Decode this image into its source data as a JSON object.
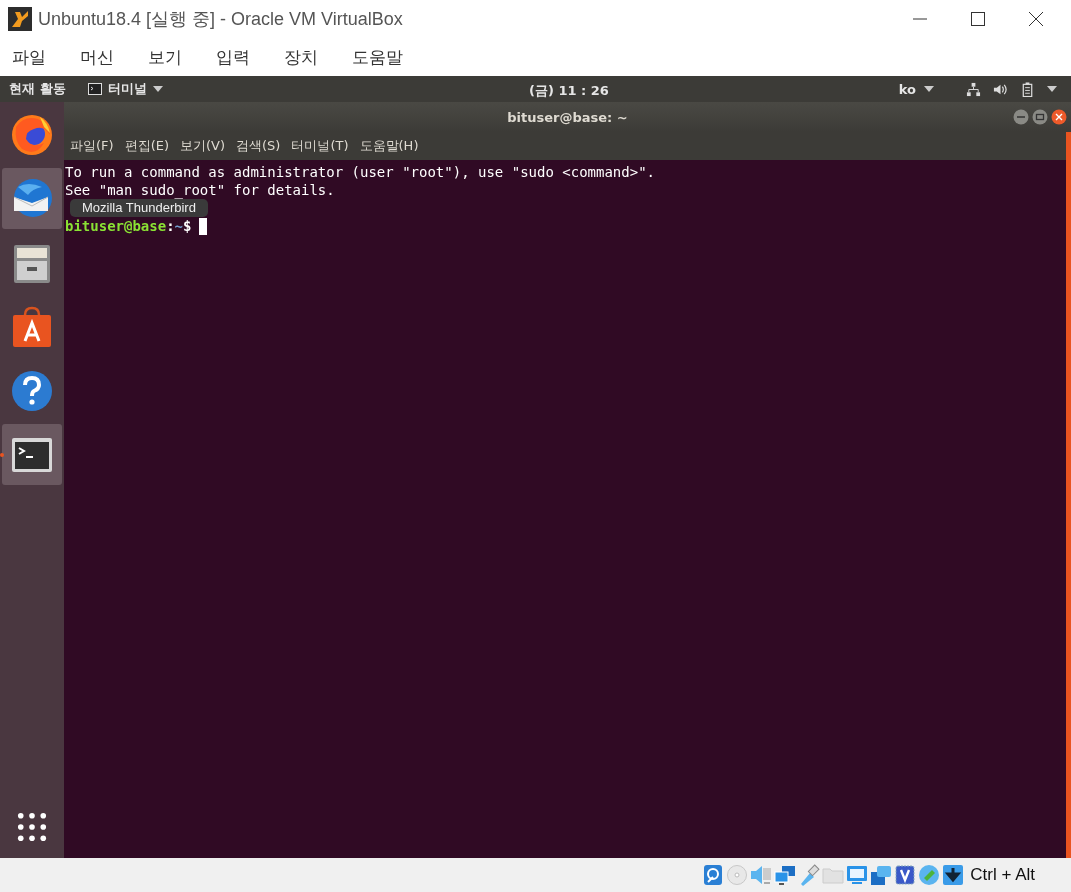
{
  "window": {
    "title": "Unbuntu18.4 [실행 중] - Oracle VM VirtualBox"
  },
  "menu": [
    "파일",
    "머신",
    "보기",
    "입력",
    "장치",
    "도움말"
  ],
  "top_bar": {
    "activities": "현재 활동",
    "app": "터미널",
    "clock": "(금) 11 : 26",
    "input_method": "ko"
  },
  "launcher": [
    {
      "kind": "firefox",
      "hovered": false,
      "running": false
    },
    {
      "kind": "thunderbird",
      "hovered": true,
      "running": false
    },
    {
      "kind": "files",
      "hovered": false,
      "running": false
    },
    {
      "kind": "software",
      "hovered": false,
      "running": false
    },
    {
      "kind": "help",
      "hovered": false,
      "running": false
    },
    {
      "kind": "terminal",
      "hovered": true,
      "running": true
    }
  ],
  "tooltip": "Mozilla Thunderbird",
  "terminal": {
    "title": "bituser@base: ~",
    "menu": [
      "파일(F)",
      "편집(E)",
      "보기(V)",
      "검색(S)",
      "터미널(T)",
      "도움말(H)"
    ],
    "lines": [
      "To run a command as administrator (user \"root\"), use \"sudo <command>\".",
      "See \"man sudo_root\" for details."
    ],
    "prompt": {
      "user": "bituser@base",
      "separator": ":",
      "path": "~",
      "symbol": "$"
    }
  },
  "status_bar": {
    "host_key": "Ctrl + Alt"
  }
}
